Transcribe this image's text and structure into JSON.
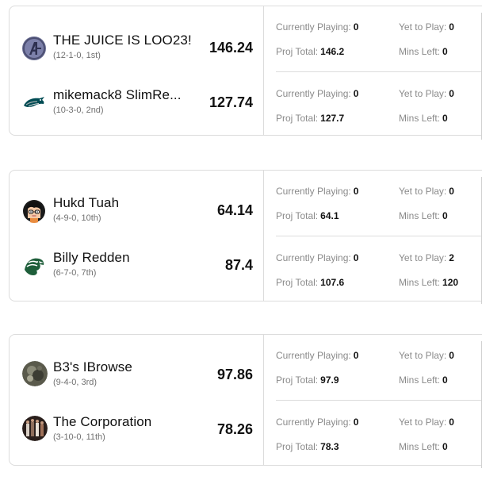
{
  "labels": {
    "currently_playing": "Currently Playing:",
    "yet_to_play": "Yet to Play:",
    "proj_total": "Proj Total:",
    "mins_left": "Mins Left:"
  },
  "matchups": [
    {
      "teams": [
        {
          "name": "THE JUICE IS LOO23!",
          "record": "(12-1-0, 1st)",
          "score": "146.24",
          "avatar": "avengers-logo-icon",
          "currently_playing": "0",
          "yet_to_play": "0",
          "proj_total": "146.2",
          "mins_left": "0"
        },
        {
          "name": "mikemack8 SlimRe...",
          "record": "(10-3-0, 2nd)",
          "score": "127.74",
          "avatar": "eagles-logo-icon",
          "currently_playing": "0",
          "yet_to_play": "0",
          "proj_total": "127.7",
          "mins_left": "0"
        }
      ]
    },
    {
      "teams": [
        {
          "name": "Hukd Tuah",
          "record": "(4-9-0, 10th)",
          "score": "64.14",
          "avatar": "cartoon-face-icon",
          "currently_playing": "0",
          "yet_to_play": "0",
          "proj_total": "64.1",
          "mins_left": "0"
        },
        {
          "name": "Billy Redden",
          "record": "(6-7-0, 7th)",
          "score": "87.4",
          "avatar": "eagle-head-logo-icon",
          "currently_playing": "0",
          "yet_to_play": "2",
          "proj_total": "107.6",
          "mins_left": "120"
        }
      ]
    },
    {
      "teams": [
        {
          "name": "B3's IBrowse",
          "record": "(9-4-0, 3rd)",
          "score": "97.86",
          "avatar": "photo-avatar-icon",
          "currently_playing": "0",
          "yet_to_play": "0",
          "proj_total": "97.9",
          "mins_left": "0"
        },
        {
          "name": "The Corporation",
          "record": "(3-10-0, 11th)",
          "score": "78.26",
          "avatar": "group-photo-avatar-icon",
          "currently_playing": "0",
          "yet_to_play": "0",
          "proj_total": "78.3",
          "mins_left": "0"
        }
      ]
    }
  ]
}
